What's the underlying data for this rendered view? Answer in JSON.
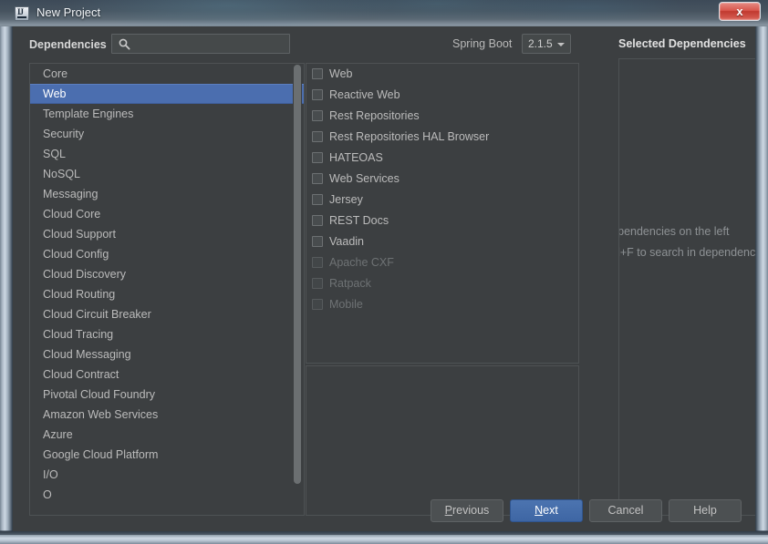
{
  "window": {
    "title": "New Project",
    "icon": "intellij-idea-icon",
    "close_label": "x"
  },
  "toolbar": {
    "dependencies_label": "Dependencies",
    "search_placeholder": "",
    "search_value": "",
    "search_icon": "search-icon",
    "spring_boot_label": "Spring Boot",
    "spring_boot_version": "2.1.5",
    "selected_dependencies_title": "Selected Dependencies"
  },
  "categories": {
    "selected": "Web",
    "items": [
      {
        "label": "Core",
        "selected": false
      },
      {
        "label": "Web",
        "selected": true
      },
      {
        "label": "Template Engines",
        "selected": false
      },
      {
        "label": "Security",
        "selected": false
      },
      {
        "label": "SQL",
        "selected": false
      },
      {
        "label": "NoSQL",
        "selected": false
      },
      {
        "label": "Messaging",
        "selected": false
      },
      {
        "label": "Cloud Core",
        "selected": false
      },
      {
        "label": "Cloud Support",
        "selected": false
      },
      {
        "label": "Cloud Config",
        "selected": false
      },
      {
        "label": "Cloud Discovery",
        "selected": false
      },
      {
        "label": "Cloud Routing",
        "selected": false
      },
      {
        "label": "Cloud Circuit Breaker",
        "selected": false
      },
      {
        "label": "Cloud Tracing",
        "selected": false
      },
      {
        "label": "Cloud Messaging",
        "selected": false
      },
      {
        "label": "Cloud Contract",
        "selected": false
      },
      {
        "label": "Pivotal Cloud Foundry",
        "selected": false
      },
      {
        "label": "Amazon Web Services",
        "selected": false
      },
      {
        "label": "Azure",
        "selected": false
      },
      {
        "label": "Google Cloud Platform",
        "selected": false
      },
      {
        "label": "I/O",
        "selected": false
      },
      {
        "label": "O",
        "selected": false
      }
    ]
  },
  "dependencies": {
    "items": [
      {
        "label": "Web",
        "checked": false,
        "enabled": true
      },
      {
        "label": "Reactive Web",
        "checked": false,
        "enabled": true
      },
      {
        "label": "Rest Repositories",
        "checked": false,
        "enabled": true
      },
      {
        "label": "Rest Repositories HAL Browser",
        "checked": false,
        "enabled": true
      },
      {
        "label": "HATEOAS",
        "checked": false,
        "enabled": true
      },
      {
        "label": "Web Services",
        "checked": false,
        "enabled": true
      },
      {
        "label": "Jersey",
        "checked": false,
        "enabled": true
      },
      {
        "label": "REST Docs",
        "checked": false,
        "enabled": true
      },
      {
        "label": "Vaadin",
        "checked": false,
        "enabled": true
      },
      {
        "label": "Apache CXF",
        "checked": false,
        "enabled": false
      },
      {
        "label": "Ratpack",
        "checked": false,
        "enabled": false
      },
      {
        "label": "Mobile",
        "checked": false,
        "enabled": false
      }
    ]
  },
  "selected_dependencies": {
    "items": [],
    "hint_line_1": "Select dependencies on the left",
    "hint_line_2": "Press Ctrl+F to search in dependencies"
  },
  "buttons": {
    "previous": {
      "prefix": "",
      "mnemonic": "P",
      "suffix": "revious"
    },
    "next": {
      "prefix": "",
      "mnemonic": "N",
      "suffix": "ext"
    },
    "cancel": {
      "prefix": "",
      "mnemonic": "",
      "suffix": "Cancel"
    },
    "help": {
      "prefix": "",
      "mnemonic": "",
      "suffix": "Help"
    }
  },
  "colors": {
    "dialog_background": "#3c3f41",
    "selection_blue": "#4b6eaf",
    "default_button_blue": "#3e66a4",
    "close_red": "#c0392f",
    "text": "#bbbbbb",
    "disabled_text": "#6e7274"
  }
}
